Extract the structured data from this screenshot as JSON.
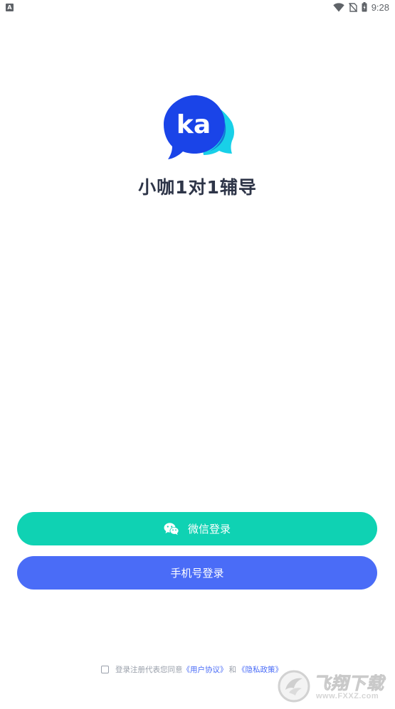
{
  "status_bar": {
    "notification_icon": "a-notification-icon",
    "notification_letter": "A",
    "wifi_icon": "wifi-icon",
    "signal_icon": "no-sim-icon",
    "battery_icon": "battery-icon",
    "time": "9:28"
  },
  "app": {
    "logo_text": "ka",
    "title": "小咖1对1辅导",
    "colors": {
      "logo_primary": "#1a44e8",
      "logo_secondary": "#18d0e8",
      "title": "#2e3548"
    }
  },
  "login": {
    "wechat_label": "微信登录",
    "wechat_icon": "wechat-icon",
    "wechat_color": "#0fd2b3",
    "phone_label": "手机号登录",
    "phone_color": "#4a6cf7"
  },
  "agreement": {
    "prefix": "登录注册代表您同意",
    "user_agreement": "《用户协议》",
    "conjunction": "和",
    "privacy_policy": "《隐私政策》",
    "checked": false
  },
  "watermark": {
    "text": "飞翔下载",
    "url": "www.FXXZ.com"
  }
}
